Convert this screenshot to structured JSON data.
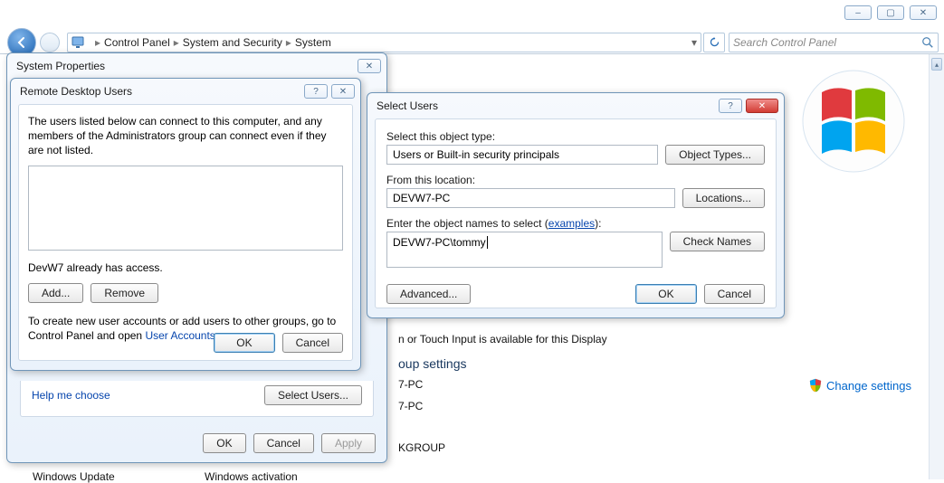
{
  "window_controls": {
    "min": "–",
    "max": "▢",
    "close": "✕"
  },
  "breadcrumbs": [
    "Control Panel",
    "System and Security",
    "System"
  ],
  "search_placeholder": "Search Control Panel",
  "background": {
    "touch_line": "n or Touch Input is available for this Display",
    "group_heading": "oup settings",
    "pc1": "7-PC",
    "pc2": "7-PC",
    "workgroup": "KGROUP",
    "windows_update": "Windows Update",
    "windows_activation": "Windows activation",
    "change_settings": "Change settings"
  },
  "sysprops": {
    "title": "System Properties",
    "help_link": "Help me choose",
    "select_users_btn": "Select Users...",
    "ok": "OK",
    "cancel": "Cancel",
    "apply": "Apply"
  },
  "rdu": {
    "title": "Remote Desktop Users",
    "desc": "The users listed below can connect to this computer, and any members of the Administrators group can connect even if they are not listed.",
    "access_line": "DevW7 already has access.",
    "add": "Add...",
    "remove": "Remove",
    "hint_pre": "To create new user accounts or add users to other groups, go to Control Panel and open ",
    "hint_link": "User Accounts",
    "ok": "OK",
    "cancel": "Cancel"
  },
  "select_users": {
    "title": "Select Users",
    "type_label": "Select this object type:",
    "type_value": "Users or Built-in security principals",
    "object_types_btn": "Object Types...",
    "location_label": "From this location:",
    "location_value": "DEVW7-PC",
    "locations_btn": "Locations...",
    "names_label_pre": "Enter the object names to select (",
    "names_label_link": "examples",
    "names_label_post": "):",
    "names_value": "DEVW7-PC\\tommy",
    "check_names_btn": "Check Names",
    "advanced_btn": "Advanced...",
    "ok": "OK",
    "cancel": "Cancel"
  }
}
